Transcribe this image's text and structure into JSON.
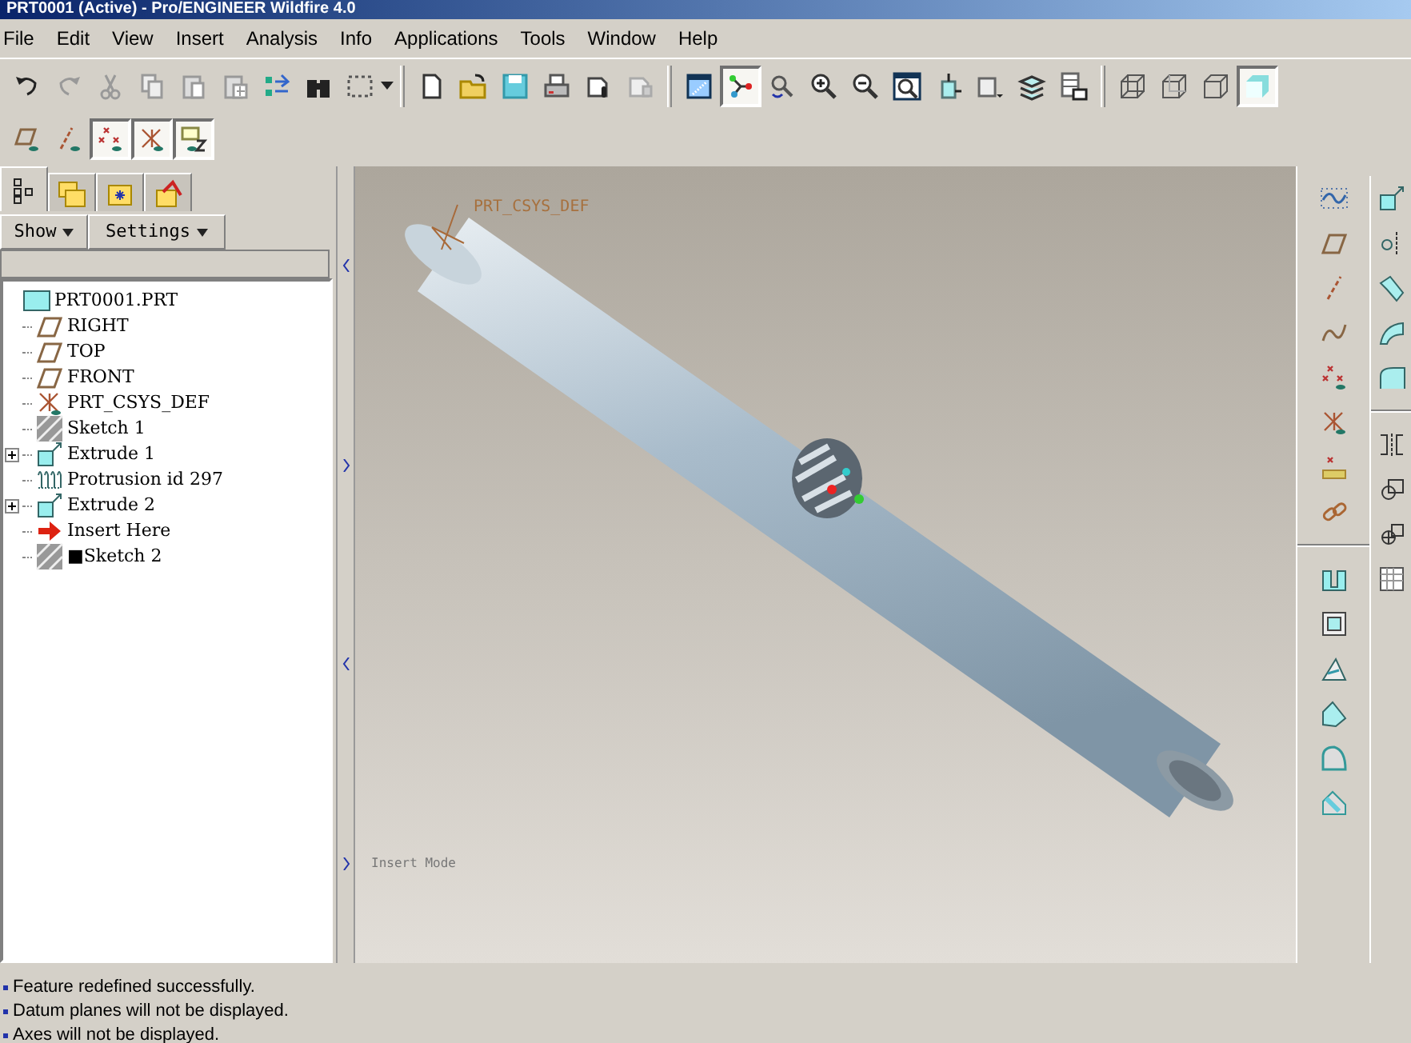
{
  "window": {
    "title": "PRT0001 (Active) - Pro/ENGINEER Wildfire 4.0"
  },
  "menu": [
    "File",
    "Edit",
    "View",
    "Insert",
    "Analysis",
    "Info",
    "Applications",
    "Tools",
    "Window",
    "Help"
  ],
  "toolbar": [
    {
      "kind": "undo",
      "pressed": false
    },
    {
      "kind": "redo",
      "pressed": false
    },
    {
      "kind": "cut",
      "pressed": false
    },
    {
      "kind": "copy",
      "pressed": false
    },
    {
      "kind": "paste",
      "pressed": false
    },
    {
      "kind": "paste-special",
      "pressed": false
    },
    {
      "kind": "regenerate",
      "pressed": false
    },
    {
      "kind": "find",
      "pressed": false
    },
    {
      "kind": "select",
      "pressed": false
    },
    {
      "kind": "sep"
    },
    {
      "kind": "new",
      "pressed": false
    },
    {
      "kind": "open",
      "pressed": false
    },
    {
      "kind": "save",
      "pressed": false
    },
    {
      "kind": "print",
      "pressed": false
    },
    {
      "kind": "mail",
      "pressed": false
    },
    {
      "kind": "mail2",
      "pressed": false
    },
    {
      "kind": "sep"
    },
    {
      "kind": "repaint",
      "pressed": false
    },
    {
      "kind": "spin",
      "pressed": true
    },
    {
      "kind": "orient",
      "pressed": false
    },
    {
      "kind": "zoomin",
      "pressed": false
    },
    {
      "kind": "zoomout",
      "pressed": false
    },
    {
      "kind": "refit",
      "pressed": false
    },
    {
      "kind": "reorient",
      "pressed": false
    },
    {
      "kind": "views",
      "pressed": false
    },
    {
      "kind": "layers",
      "pressed": false
    },
    {
      "kind": "table",
      "pressed": false
    },
    {
      "kind": "sep"
    },
    {
      "kind": "wire",
      "pressed": false
    },
    {
      "kind": "hidden",
      "pressed": false
    },
    {
      "kind": "nohidden",
      "pressed": false
    },
    {
      "kind": "shade",
      "pressed": true
    }
  ],
  "datum_toolbar": [
    {
      "kind": "planes",
      "pressed": false
    },
    {
      "kind": "axes",
      "pressed": false
    },
    {
      "kind": "points",
      "pressed": true
    },
    {
      "kind": "csys",
      "pressed": true
    },
    {
      "kind": "annotations",
      "pressed": true
    }
  ],
  "panel_tabs": [
    {
      "kind": "tree",
      "selected": true
    },
    {
      "kind": "folders",
      "selected": false
    },
    {
      "kind": "favorites",
      "selected": false
    },
    {
      "kind": "tools",
      "selected": false
    }
  ],
  "panel_buttons": [
    "Show",
    "Settings"
  ],
  "model_tree": {
    "label": "PRT0001.PRT",
    "children": [
      {
        "kind": "plane",
        "label": "RIGHT"
      },
      {
        "kind": "plane",
        "label": "TOP"
      },
      {
        "kind": "plane",
        "label": "FRONT"
      },
      {
        "kind": "csys",
        "label": "PRT_CSYS_DEF"
      },
      {
        "kind": "sketch",
        "label": "Sketch 1"
      },
      {
        "kind": "extrude",
        "label": "Extrude 1",
        "expanded": false
      },
      {
        "kind": "protrusion",
        "label": "Protrusion id 297"
      },
      {
        "kind": "extrude",
        "label": "Extrude 2",
        "expanded": false
      },
      {
        "kind": "insert",
        "label": "Insert Here"
      },
      {
        "kind": "sketch",
        "label": "■Sketch 2"
      }
    ]
  },
  "graphics": {
    "csys_label": "PRT_CSYS_DEF",
    "mode": "Insert Mode"
  },
  "right_toolbar": [
    {
      "kind": "sketchcurve"
    },
    {
      "kind": "plane"
    },
    {
      "kind": "axis"
    },
    {
      "kind": "curve"
    },
    {
      "kind": "points"
    },
    {
      "kind": "csys"
    },
    {
      "kind": "analysis"
    },
    {
      "kind": "chain"
    },
    {
      "kind": "sep"
    },
    {
      "kind": "hole"
    },
    {
      "kind": "shell"
    },
    {
      "kind": "rib"
    },
    {
      "kind": "draft"
    },
    {
      "kind": "round"
    },
    {
      "kind": "chamfer"
    }
  ],
  "right_toolbar_2": [
    {
      "kind": "extrude"
    },
    {
      "kind": "revolve"
    },
    {
      "kind": "sweep"
    },
    {
      "kind": "blend"
    },
    {
      "kind": "surface"
    },
    {
      "kind": "sep"
    },
    {
      "kind": "mirror"
    },
    {
      "kind": "merge"
    },
    {
      "kind": "trim"
    },
    {
      "kind": "pattern"
    }
  ],
  "messages": [
    "Feature redefined successfully.",
    "Datum planes will not be displayed.",
    "Axes will not be displayed."
  ]
}
